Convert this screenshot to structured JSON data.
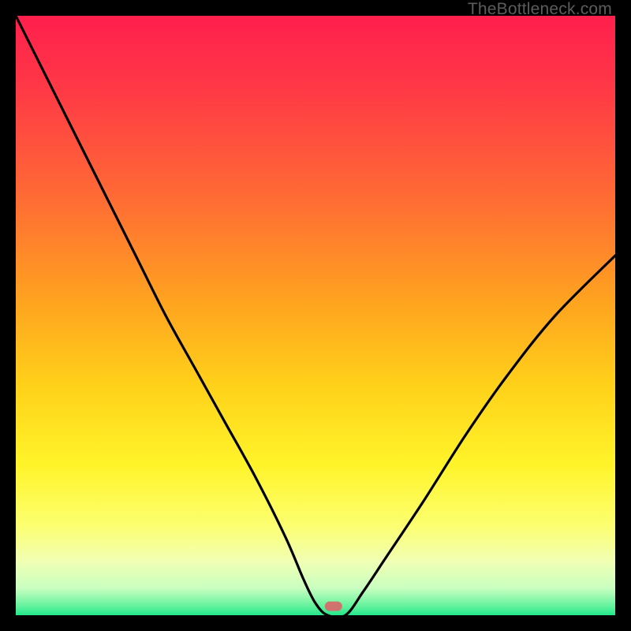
{
  "watermark": "TheBottleneck.com",
  "chart_data": {
    "type": "line",
    "title": "",
    "xlabel": "",
    "ylabel": "",
    "xlim": [
      0,
      100
    ],
    "ylim": [
      0,
      100
    ],
    "grid": false,
    "legend": false,
    "background_gradient": {
      "stops": [
        {
          "pos": 0.0,
          "color": "#ff1f4d"
        },
        {
          "pos": 0.12,
          "color": "#ff3846"
        },
        {
          "pos": 0.3,
          "color": "#ff6a35"
        },
        {
          "pos": 0.48,
          "color": "#ffa41f"
        },
        {
          "pos": 0.62,
          "color": "#ffd21a"
        },
        {
          "pos": 0.75,
          "color": "#fff42a"
        },
        {
          "pos": 0.85,
          "color": "#fcff70"
        },
        {
          "pos": 0.91,
          "color": "#f1ffb4"
        },
        {
          "pos": 0.955,
          "color": "#c9ffc0"
        },
        {
          "pos": 0.985,
          "color": "#63f29d"
        },
        {
          "pos": 1.0,
          "color": "#22e78a"
        }
      ]
    },
    "series": [
      {
        "name": "bottleneck-curve",
        "color": "#000000",
        "x": [
          0,
          5,
          10,
          15,
          20,
          25,
          30,
          35,
          40,
          45,
          48,
          50,
          52,
          55,
          58,
          62,
          68,
          75,
          82,
          90,
          100
        ],
        "y": [
          100,
          90,
          80,
          70,
          60,
          50,
          41,
          32,
          23,
          13,
          6,
          2,
          0,
          0,
          4,
          10,
          19,
          30,
          40,
          50,
          60
        ]
      }
    ],
    "markers": [
      {
        "name": "optimal-point",
        "x": 53,
        "y": 1.5,
        "shape": "pill",
        "color": "#d0736f"
      }
    ]
  }
}
